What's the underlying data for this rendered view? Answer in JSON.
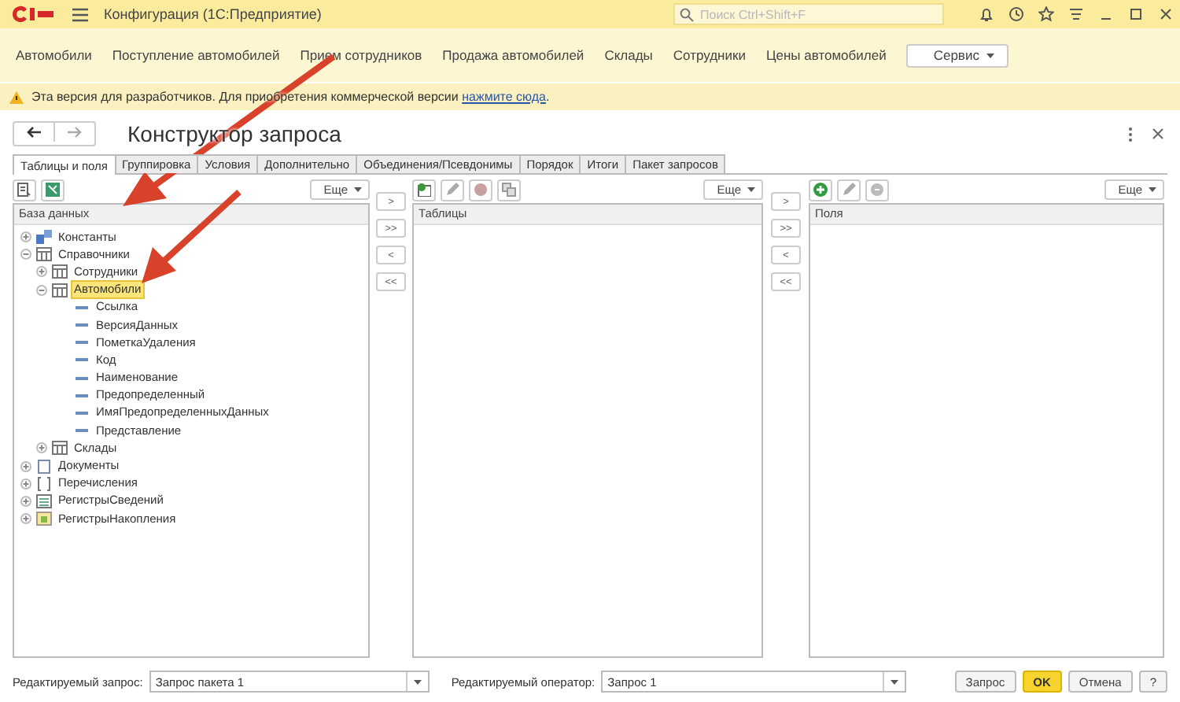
{
  "app": {
    "title": "Конфигурация (1С:Предприятие)",
    "search_placeholder": "Поиск Ctrl+Shift+F"
  },
  "nav": {
    "items": [
      "Автомобили",
      "Поступление автомобилей",
      "Прием сотрудников",
      "Продажа автомобилей",
      "Склады",
      "Сотрудники",
      "Цены автомобилей"
    ],
    "service_button": "Сервис"
  },
  "notice": {
    "text": "Эта версия для разработчиков. Для приобретения коммерческой версии ",
    "link": "нажмите сюда",
    "end": "."
  },
  "designer": {
    "title": "Конструктор запроса",
    "tabs": [
      {
        "label": "Таблицы и поля",
        "selected": true
      },
      {
        "label": "Группировка",
        "selected": false
      },
      {
        "label": "Условия",
        "selected": false
      },
      {
        "label": "Дополнительно",
        "selected": false
      },
      {
        "label": "Объединения/Псевдонимы",
        "selected": false
      },
      {
        "label": "Порядок",
        "selected": false
      },
      {
        "label": "Итоги",
        "selected": false
      },
      {
        "label": "Пакет запросов",
        "selected": false
      }
    ],
    "source_panel": {
      "more_button": "Еще",
      "header": "База данных",
      "tree": [
        {
          "label": "Константы",
          "kind": "constants",
          "expanded": false,
          "selected": false
        },
        {
          "label": "Справочники",
          "kind": "catalog",
          "expanded": true,
          "selected": false,
          "children": [
            {
              "label": "Сотрудники",
              "kind": "catalog",
              "expanded": false,
              "selected": false
            },
            {
              "label": "Автомобили",
              "kind": "catalog",
              "expanded": true,
              "selected": true,
              "children": [
                {
                  "label": "Ссылка",
                  "kind": "field",
                  "selected": false
                },
                {
                  "label": "ВерсияДанных",
                  "kind": "field",
                  "selected": false
                },
                {
                  "label": "ПометкаУдаления",
                  "kind": "field",
                  "selected": false
                },
                {
                  "label": "Код",
                  "kind": "field",
                  "selected": false
                },
                {
                  "label": "Наименование",
                  "kind": "field",
                  "selected": false
                },
                {
                  "label": "Предопределенный",
                  "kind": "field",
                  "selected": false
                },
                {
                  "label": "ИмяПредопределенныхДанных",
                  "kind": "field",
                  "selected": false
                },
                {
                  "label": "Представление",
                  "kind": "field",
                  "selected": false
                }
              ]
            },
            {
              "label": "Склады",
              "kind": "catalog",
              "expanded": false,
              "selected": false
            }
          ]
        },
        {
          "label": "Документы",
          "kind": "document",
          "expanded": false,
          "selected": false
        },
        {
          "label": "Перечисления",
          "kind": "enum",
          "expanded": false,
          "selected": false
        },
        {
          "label": "РегистрыСведений",
          "kind": "info-register",
          "expanded": false,
          "selected": false
        },
        {
          "label": "РегистрыНакопления",
          "kind": "accum-register",
          "expanded": false,
          "selected": false
        }
      ]
    },
    "move_buttons_left": [
      ">",
      ">>",
      "<",
      "<<"
    ],
    "tables_panel": {
      "more_button": "Еще",
      "header": "Таблицы"
    },
    "move_buttons_right": [
      ">",
      ">>",
      "<",
      "<<"
    ],
    "fields_panel": {
      "more_button": "Еще",
      "header": "Поля"
    },
    "query_label": "Редактируемый запрос:",
    "query_value": "Запрос пакета 1",
    "operator_label": "Редактируемый оператор:",
    "operator_value": "Запрос 1",
    "buttons": [
      {
        "label": "Запрос",
        "default": false
      },
      {
        "label": "OK",
        "default": true
      },
      {
        "label": "Отмена",
        "default": false
      },
      {
        "label": "?",
        "default": false
      }
    ]
  }
}
